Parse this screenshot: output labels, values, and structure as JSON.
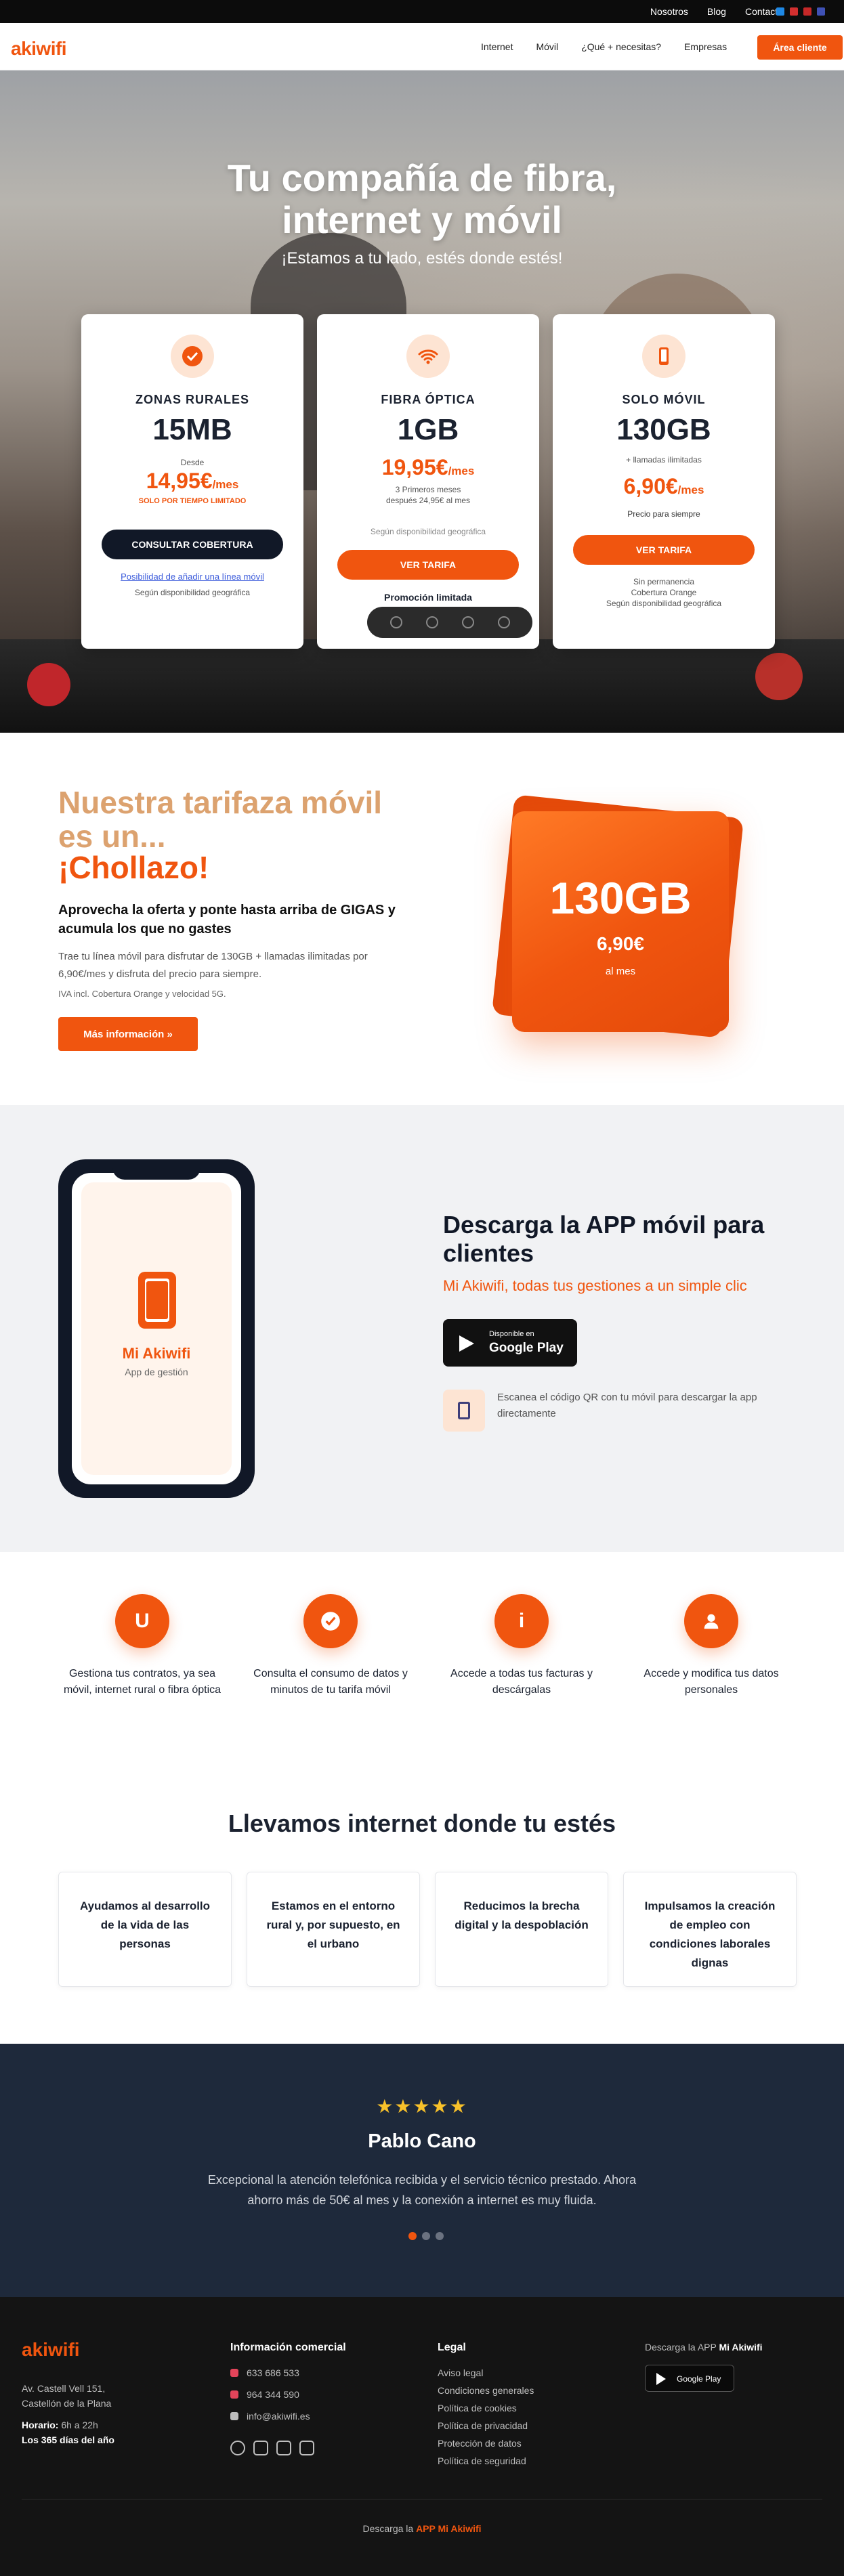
{
  "topbar": {
    "links": [
      "Nosotros",
      "Blog",
      "Contacto"
    ],
    "flag_colors": [
      "#1e88e5",
      "#d32f2f",
      "#c62828",
      "#3f51b5"
    ]
  },
  "header": {
    "logo": "akiwifi",
    "nav": [
      "Internet",
      "Móvil",
      "¿Qué + necesitas?",
      "Empresas"
    ],
    "client_button": "Área cliente"
  },
  "hero": {
    "title_line1": "Tu compañía de fibra,",
    "title_line2": "internet y móvil",
    "subtitle": "¡Estamos a tu lado, estés donde estés!",
    "cards": [
      {
        "icon": "check-badge-icon",
        "name": "ZONAS RURALES",
        "gb": "15MB",
        "pre": "Desde",
        "price": "14,95€",
        "unit": "/mes",
        "note": "SOLO POR TIEMPO LIMITADO",
        "button": "CONSULTAR COBERTURA",
        "link": "Posibilidad de añadir una línea móvil",
        "footnote": "Según disponibilidad geográfica"
      },
      {
        "icon": "wifi-icon",
        "name": "FIBRA ÓPTICA",
        "gb": "1GB",
        "price": "19,95€",
        "unit": "/mes",
        "detail1": "3 Primeros meses",
        "detail2": "después 24,95€ al mes",
        "availability": "Según disponibilidad geográfica",
        "button": "VER TARIFA",
        "promo": "Promoción limitada"
      },
      {
        "icon": "phone-icon",
        "name": "SOLO MÓVIL",
        "gb": "130GB",
        "extra": "+ llamadas ilimitadas",
        "price": "6,90€",
        "unit": "/mes",
        "forever": "Precio para siempre",
        "button": "VER TARIFA",
        "f1": "Sin permanencia",
        "f2": "Cobertura Orange",
        "f3": "Según disponibilidad geográfica"
      }
    ]
  },
  "promo": {
    "title1a": "Nuestra tarifaza móvil",
    "title1b": "es un...",
    "title2": "¡Chollazo!",
    "subtitle": "Aprovecha la oferta y ponte hasta arriba de GIGAS y acumula los que no gastes",
    "text": "Trae tu línea móvil para disfrutar de 130GB + llamadas ilimitadas por 6,90€/mes y disfruta del precio para siempre.",
    "note": "IVA incl. Cobertura Orange y velocidad 5G.",
    "button": "Más información »",
    "card_gb": "130GB",
    "card_price": "6,90€",
    "card_period": "al mes"
  },
  "app": {
    "phone_title": "Mi Akiwifi",
    "phone_sub": "App de gestión",
    "title": "Descarga la APP móvil para clientes",
    "subtitle": "Mi Akiwifi, todas tus gestiones a un simple clic",
    "gplay_top": "Disponible en",
    "gplay_main": "Google Play",
    "qr_text": "Escanea el código QR con tu móvil para descargar la app directamente"
  },
  "features": [
    {
      "icon": "user-u-icon",
      "glyph": "U",
      "text": "Gestiona tus contratos, ya sea móvil, internet rural o fibra óptica"
    },
    {
      "icon": "check-icon",
      "glyph": "✓",
      "text": "Consulta el consumo de datos y minutos de tu tarifa móvil"
    },
    {
      "icon": "info-icon",
      "glyph": "i",
      "text": "Accede a todas tus facturas y descárgalas"
    },
    {
      "icon": "user-icon",
      "glyph": "●",
      "text": "Accede y modifica tus datos personales"
    }
  ],
  "internet": {
    "title": "Llevamos internet donde tu estés",
    "boxes": [
      "Ayudamos al desarrollo de la vida de las personas",
      "Estamos en el entorno rural y, por supuesto, en el urbano",
      "Reducimos la brecha digital y la despoblación",
      "Impulsamos la creación de empleo con condiciones laborales dignas"
    ]
  },
  "testimonial": {
    "stars": "★★★★★",
    "name": "Pablo Cano",
    "quote": "Excepcional la atención telefónica recibida y el servicio técnico prestado. Ahora ahorro más de 50€ al mes y la conexión a internet es muy fluida."
  },
  "footer": {
    "logo": "akiwifi",
    "address1": "Av. Castell Vell 151,",
    "address2": "Castellón de la Plana",
    "hours_label": "Horario:",
    "hours_value": "6h a 22h",
    "hours_days": "Los 365 días del año",
    "info_title": "Información comercial",
    "phone1": "633 686 533",
    "phone2": "964 344 590",
    "email": "info@akiwifi.es",
    "legal_title": "Legal",
    "legal": [
      "Aviso legal",
      "Condiciones generales",
      "Política de cookies",
      "Política de privacidad",
      "Protección de datos",
      "Política de seguridad"
    ],
    "app_text": "Descarga la APP",
    "app_name": "Mi Akiwifi",
    "gplay": "Google Play",
    "bottom_text": "Descarga la",
    "bottom_link": "APP Mi Akiwifi"
  }
}
